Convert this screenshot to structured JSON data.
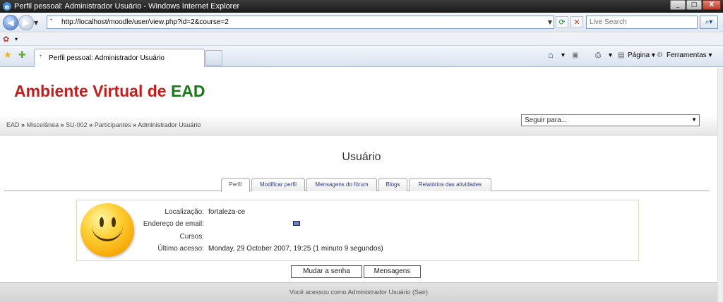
{
  "window": {
    "title": "Perfil pessoal: Administrador Usuário - Windows Internet Explorer",
    "minimize": "_",
    "maximize": "□",
    "close": "X"
  },
  "address_bar": {
    "url": "http://localhost/moodle/user/view.php?id=2&course=2",
    "search_placeholder": "Live Search"
  },
  "browser_tab": {
    "label": "Perfil pessoal: Administrador Usuário"
  },
  "command_bar": {
    "page_label": "Página",
    "tools_label": "Ferramentas"
  },
  "site": {
    "title_part1": "Ambiente Virtual de",
    "title_part2": "EAD"
  },
  "breadcrumb": {
    "items": [
      "EAD",
      "Miscelânea",
      "SU-002",
      "Participantes",
      "Administrador Usuário"
    ],
    "separator": "»"
  },
  "jump_menu": {
    "selected": "Seguir para..."
  },
  "page": {
    "heading": "Usuário"
  },
  "tabs": [
    {
      "label": "Perfil"
    },
    {
      "label": "Modificar perfil"
    },
    {
      "label": "Mensagens do fórum"
    },
    {
      "label": "Blogs"
    },
    {
      "label": "Relatórios das atividades"
    }
  ],
  "profile": {
    "location_label": "Localização:",
    "location_value": "fortaleza-ce",
    "email_label": "Endereço de email:",
    "courses_label": "Cursos:",
    "last_access_label": "Último acesso:",
    "last_access_value": "Monday, 29 October 2007, 19:25  (1 minuto 9 segundos)"
  },
  "buttons": {
    "change_password": "Mudar a senha",
    "messages": "Mensagens"
  },
  "footer": {
    "text": "Você acessou como Administrador Usuário (Sair)"
  }
}
